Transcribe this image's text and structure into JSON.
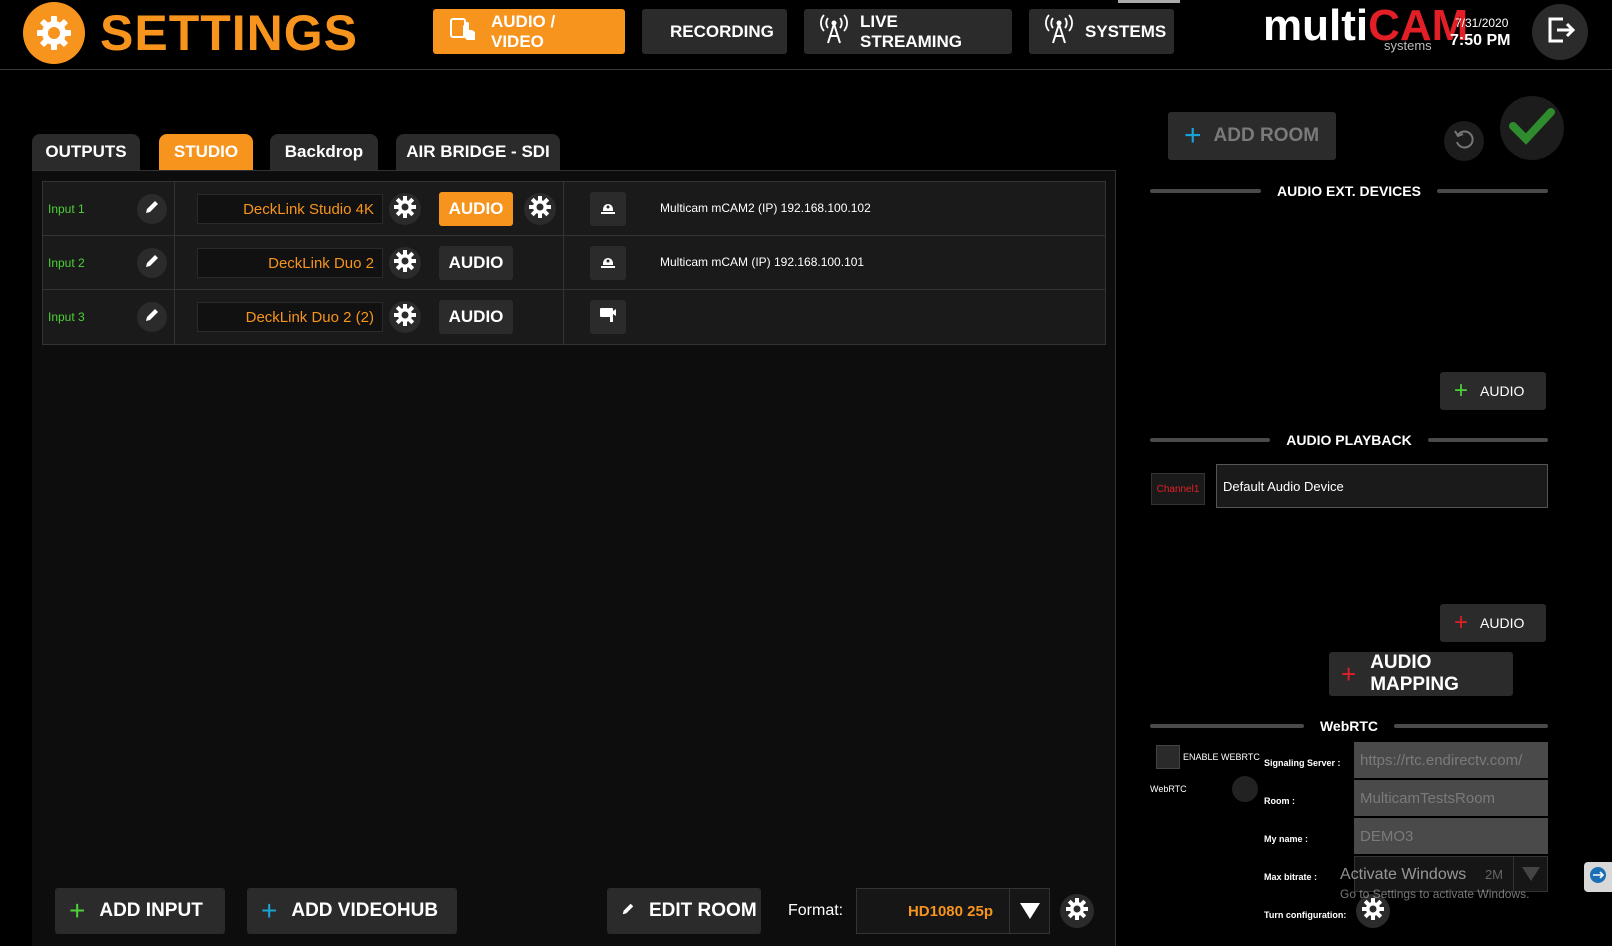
{
  "header": {
    "title": "SETTINGS",
    "nav": [
      {
        "label": "AUDIO / VIDEO",
        "icon": "hand-pointer-icon",
        "active": true
      },
      {
        "label": "RECORDING",
        "icon": "record-dot-icon",
        "active": false
      },
      {
        "label": "LIVE STREAMING",
        "icon": "antenna-icon",
        "active": false
      },
      {
        "label": "SYSTEMS",
        "icon": "antenna-icon",
        "active": false
      }
    ],
    "brand_multi": "multi",
    "brand_cam": "CAM",
    "brand_sub": "systems",
    "date": "7/31/2020",
    "time": "7:50 PM"
  },
  "tabs": [
    {
      "label": "OUTPUTS",
      "active": false
    },
    {
      "label": "STUDIO",
      "active": true
    },
    {
      "label": "Backdrop",
      "active": false
    },
    {
      "label": "AIR BRIDGE - SDI",
      "active": false
    }
  ],
  "actions": {
    "add_room": "ADD ROOM"
  },
  "inputs": [
    {
      "label": "Input 1",
      "device": "DeckLink Studio 4K",
      "audio": "AUDIO",
      "audio_active": true,
      "source": "Multicam mCAM2 (IP) 192.168.100.102"
    },
    {
      "label": "Input 2",
      "device": "DeckLink Duo 2",
      "audio": "AUDIO",
      "audio_active": false,
      "source": "Multicam mCAM (IP) 192.168.100.101"
    },
    {
      "label": "Input 3",
      "device": "DeckLink Duo 2 (2)",
      "audio": "AUDIO",
      "audio_active": false,
      "source": ""
    }
  ],
  "bottom": {
    "add_input": "ADD INPUT",
    "add_videohub": "ADD VIDEOHUB",
    "edit_room": "EDIT ROOM",
    "format_label": "Format:",
    "format_value": "HD1080 25p"
  },
  "right": {
    "audio_ext_title": "AUDIO EXT. DEVICES",
    "add_audio_1": "AUDIO",
    "audio_playback_title": "AUDIO PLAYBACK",
    "channel": "Channel1",
    "playback_device": "Default Audio Device",
    "add_audio_2": "AUDIO",
    "audio_mapping": "AUDIO MAPPING",
    "webrtc_title": "WebRTC",
    "enable_webrtc": "ENABLE WEBRTC",
    "webrtc_label": "WebRTC",
    "signaling_label": "Signaling Server :",
    "signaling_value": "https://rtc.endirectv.com/",
    "room_label": "Room :",
    "room_value": "MulticamTestsRoom",
    "myname_label": "My name :",
    "myname_value": "DEMO3",
    "maxbitrate_label": "Max bitrate :",
    "maxbitrate_value": "2M",
    "turn_label": "Turn configuration:"
  },
  "watermark": {
    "title": "Activate Windows",
    "sub": "Go to Settings to activate Windows."
  },
  "colors": {
    "accent": "#f7941d",
    "brand_red": "#e21f26",
    "input_green": "#4cd137",
    "add_blue": "#1aa3d5",
    "button_bg": "#2b2b2b"
  }
}
